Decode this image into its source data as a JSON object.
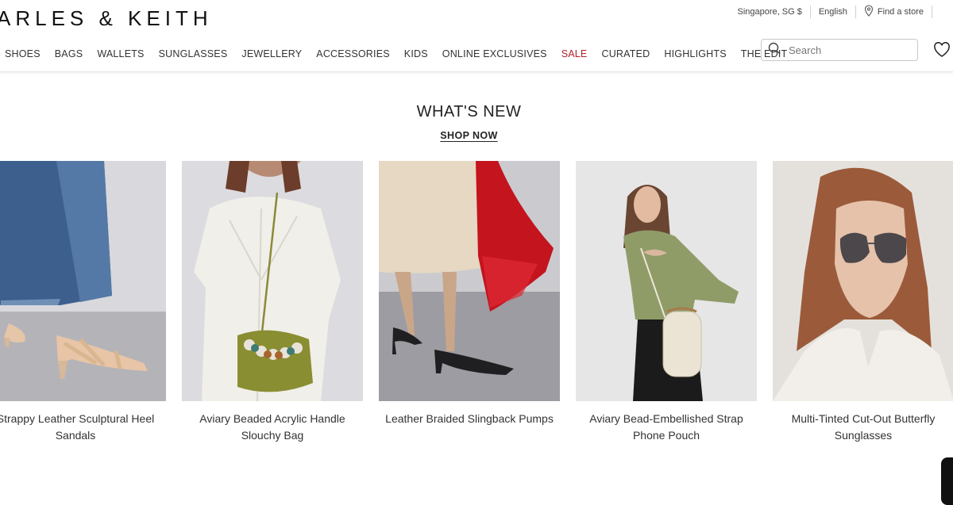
{
  "brand": {
    "logo_text": "ARLES & KEITH"
  },
  "utility": {
    "region": "Singapore, SG $",
    "language": "English",
    "store_finder": "Find a store"
  },
  "nav": {
    "items": [
      "SHOES",
      "BAGS",
      "WALLETS",
      "SUNGLASSES",
      "JEWELLERY",
      "ACCESSORIES",
      "KIDS",
      "ONLINE EXCLUSIVES",
      "SALE",
      "CURATED",
      "HIGHLIGHTS",
      "THE EDIT"
    ],
    "sale_color": "#b0202a"
  },
  "search": {
    "placeholder": "Search"
  },
  "section": {
    "title": "WHAT'S NEW",
    "cta": "SHOP NOW"
  },
  "products": [
    {
      "name": "Strappy Leather Sculptural Heel Sandals",
      "image": "denim-jeans-beige-heel-sandals"
    },
    {
      "name": "Aviary Beaded Acrylic Handle Slouchy Bag",
      "image": "white-blazer-olive-beaded-bag"
    },
    {
      "name": "Leather Braided Slingback Pumps",
      "image": "beige-skirt-red-scarf-black-slingbacks"
    },
    {
      "name": "Aviary Bead-Embellished Strap Phone Pouch",
      "image": "olive-top-cream-phone-pouch"
    },
    {
      "name": "Multi-Tinted Cut-Out Butterfly Sunglasses",
      "image": "woman-white-shirt-butterfly-sunglasses"
    }
  ],
  "icons": {
    "search": "search-icon",
    "heart": "heart-icon",
    "location": "location-pin-icon"
  }
}
